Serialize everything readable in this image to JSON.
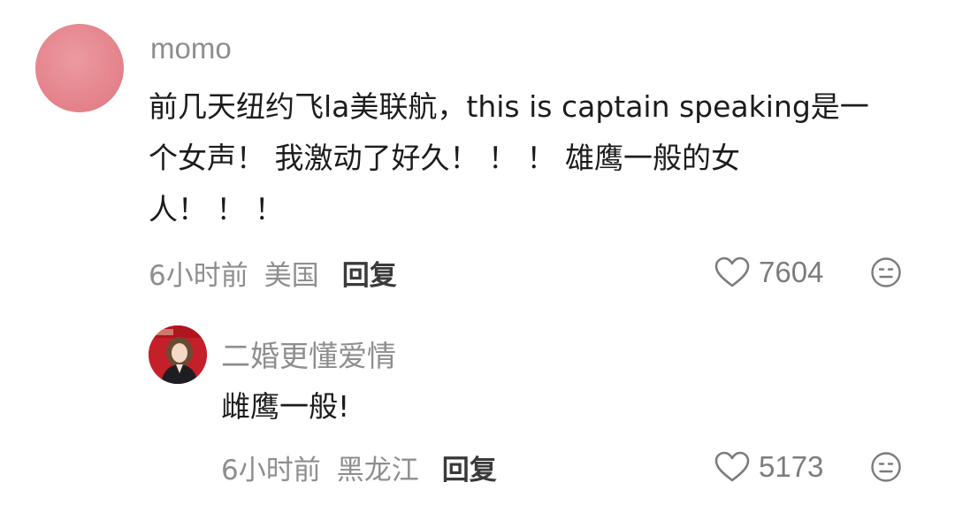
{
  "comment": {
    "username": "momo",
    "avatar_color": "#e5848d",
    "text": "前几天纽约飞la美联航，this is captain speaking是一\n个女声！ 我激动了好久！ ！ ！ 雄鹰一般的女\n人！ ！ ！",
    "time": "6小时前",
    "location": "美国",
    "reply_label": "回复",
    "like_count": "7604",
    "like_icon": "heart-outline-icon",
    "emoji_icon": "smiley-face-icon",
    "reply": {
      "username": "二婚更懂爱情",
      "avatar_color": "#c8202a",
      "text": "雌鹰一般!",
      "time": "6小时前",
      "location": "黑龙江",
      "reply_label": "回复",
      "like_count": "5173",
      "like_icon": "heart-outline-icon",
      "emoji_icon": "smiley-face-icon"
    }
  },
  "colors": {
    "meta_gray": "#8e8e8e",
    "text_dark": "#1c1c1c",
    "reply_dark": "#3a3a3a"
  }
}
